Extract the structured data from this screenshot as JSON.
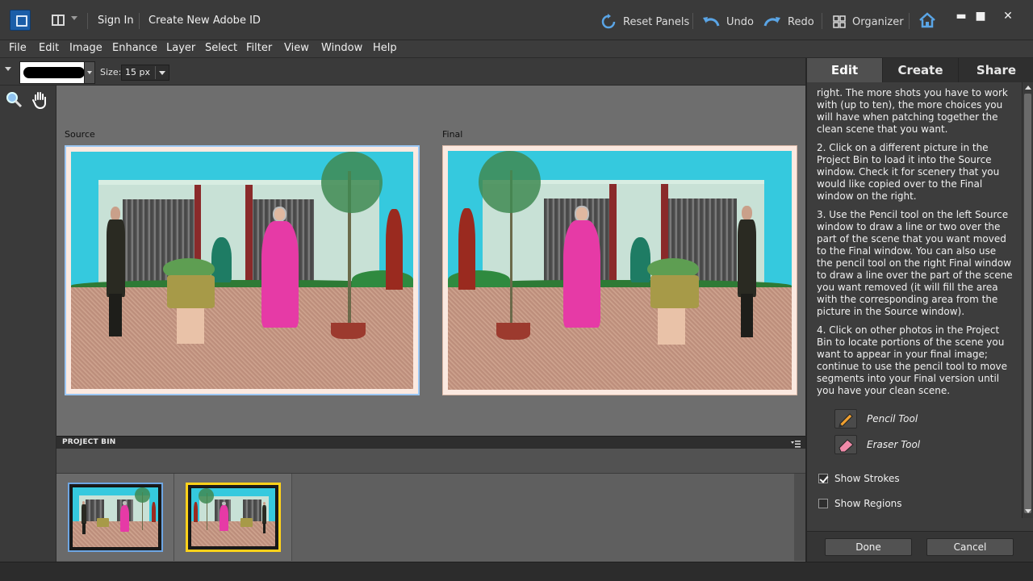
{
  "titlebar": {
    "sign_in": "Sign In",
    "create_id": "Create New Adobe ID",
    "reset_panels": "Reset Panels",
    "undo": "Undo",
    "redo": "Redo",
    "organizer": "Organizer"
  },
  "menu": [
    "File",
    "Edit",
    "Image",
    "Enhance",
    "Layer",
    "Select",
    "Filter",
    "View",
    "Window",
    "Help"
  ],
  "options": {
    "size_label": "Size:",
    "size_value": "15 px"
  },
  "canvas": {
    "source_label": "Source",
    "final_label": "Final"
  },
  "project_bin": {
    "title": "PROJECT BIN"
  },
  "panel": {
    "tabs": [
      "Edit",
      "Create",
      "Share"
    ],
    "active_tab": "Edit",
    "paragraphs": [
      "right. The more shots you have to work with (up to ten), the more choices you will have when patching together the clean scene that you want.",
      "2. Click on a different picture in the Project Bin to load it into the Source window. Check it for scenery that you would like copied over to the Final window on the right.",
      "3. Use the Pencil tool on the left Source window to draw a line or two over the part of the scene that you want moved to the Final window. You can also use the pencil tool on the right Final window to draw a line over the part of the scene you want removed (it will fill the area with the corresponding area from the picture in the Source window).",
      "4. Click on other photos in the Project Bin to locate portions of the scene you want to appear in your final image; continue to use the pencil tool to move segments into your Final version until you have your clean scene."
    ],
    "pencil_tool": "Pencil Tool",
    "eraser_tool": "Eraser Tool",
    "show_strokes": "Show Strokes",
    "show_regions": "Show Regions",
    "show_strokes_checked": true,
    "show_regions_checked": false,
    "done": "Done",
    "cancel": "Cancel"
  },
  "colors": {
    "accent_selection": "#9cc7f4",
    "final_highlight": "#ffd21a"
  }
}
